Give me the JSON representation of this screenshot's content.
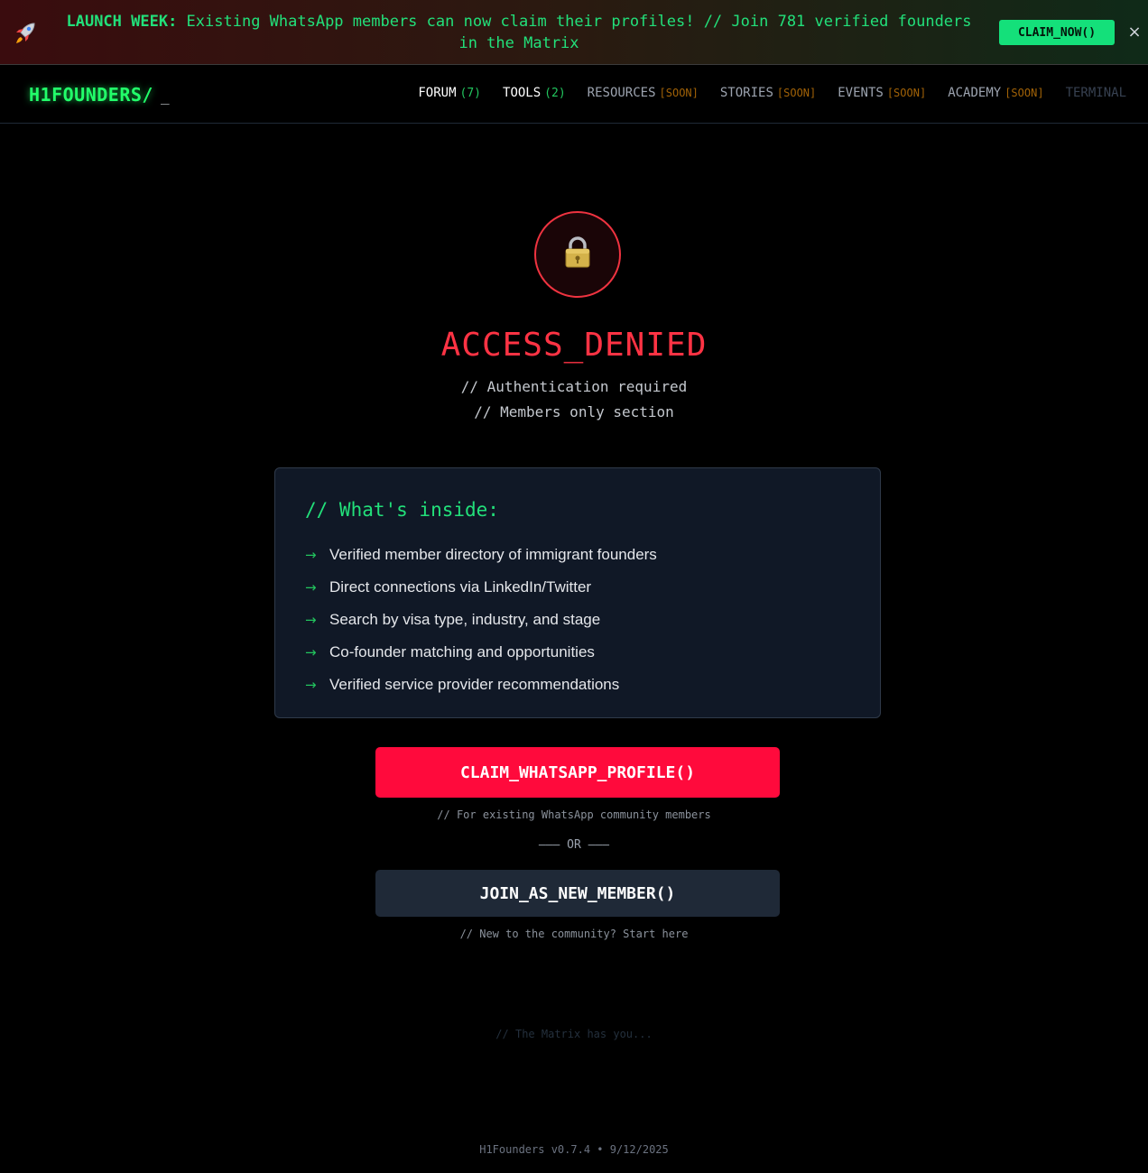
{
  "banner": {
    "icon": "rocket-icon",
    "bold_text": "LAUNCH WEEK:",
    "message": " Existing WhatsApp members can now claim their profiles! // Join 781 verified founders in the Matrix",
    "cta": "CLAIM_NOW()",
    "close": "×"
  },
  "nav": {
    "logo": "H1FOUNDERS/",
    "cursor": "_",
    "items": [
      {
        "label": "FORUM",
        "count": "(7)"
      },
      {
        "label": "TOOLS",
        "count": "(2)"
      },
      {
        "label": "RESOURCES",
        "badge": "[SOON]"
      },
      {
        "label": "STORIES",
        "badge": "[SOON]"
      },
      {
        "label": "EVENTS",
        "badge": "[SOON]"
      },
      {
        "label": "ACADEMY",
        "badge": "[SOON]"
      },
      {
        "label": "TERMINAL"
      }
    ]
  },
  "gate": {
    "icon": "lock-icon",
    "title": "ACCESS_DENIED",
    "line1": "// Authentication required",
    "line2": "// Members only section"
  },
  "card": {
    "title": "// What's inside:",
    "arrow": "→",
    "items": [
      "Verified member directory of immigrant founders",
      "Direct connections via LinkedIn/Twitter",
      "Search by visa type, industry, and stage",
      "Co-founder matching and opportunities",
      "Verified service provider recommendations"
    ]
  },
  "actions": {
    "primary": "CLAIM_WHATSAPP_PROFILE()",
    "primary_hint": "// For existing WhatsApp community members",
    "divider": "——— OR ———",
    "secondary": "JOIN_AS_NEW_MEMBER()",
    "secondary_hint": "// New to the community? Start here"
  },
  "matrix_text": "// The Matrix has you...",
  "footer": "H1Founders v0.7.4 • 9/12/2025",
  "colors": {
    "accent_green": "#22e07a",
    "danger_red": "#ff0a3c",
    "background": "#000000"
  }
}
